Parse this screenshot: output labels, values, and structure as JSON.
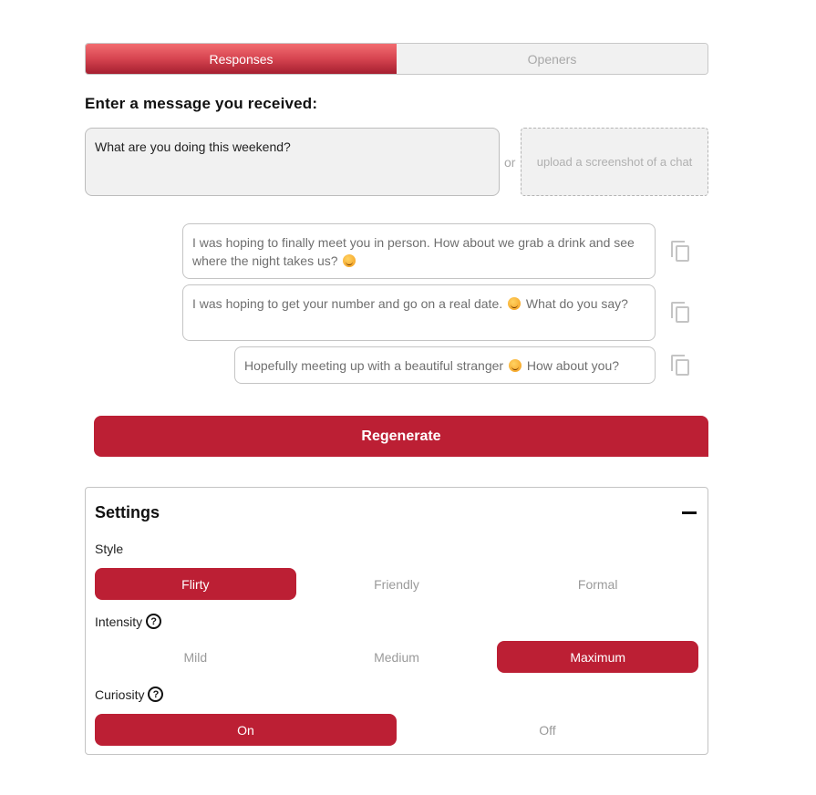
{
  "tabs": [
    {
      "label": "Responses",
      "active": true
    },
    {
      "label": "Openers",
      "active": false
    }
  ],
  "input": {
    "label": "Enter a message you received:",
    "value": "What are you doing this weekend?",
    "or_text": "or",
    "upload_label": "upload a screenshot of a chat"
  },
  "responses": [
    {
      "text_before": "I was hoping to finally meet you in person. How about we grab a drink and see where the night takes us?",
      "emoji": "winking-face",
      "text_after": ""
    },
    {
      "text_before": "I was hoping to get your number and go on a real date.",
      "emoji": "winking-face",
      "text_after": "What do you say?"
    },
    {
      "text_before": "Hopefully meeting up with a beautiful stranger",
      "emoji": "winking-face",
      "text_after": "How about you?"
    }
  ],
  "regenerate_label": "Regenerate",
  "settings": {
    "title": "Settings",
    "style": {
      "label": "Style",
      "options": [
        "Flirty",
        "Friendly",
        "Formal"
      ],
      "selected": "Flirty"
    },
    "intensity": {
      "label": "Intensity",
      "help": "?",
      "options": [
        "Mild",
        "Medium",
        "Maximum"
      ],
      "selected": "Maximum"
    },
    "curiosity": {
      "label": "Curiosity",
      "help": "?",
      "options": [
        "On",
        "Off"
      ],
      "selected": "On"
    }
  },
  "colors": {
    "accent": "#bc1f34",
    "tab_gradient_top": "#f26c70",
    "tab_gradient_bottom": "#a51f30",
    "muted_text": "#9a9a9a"
  }
}
